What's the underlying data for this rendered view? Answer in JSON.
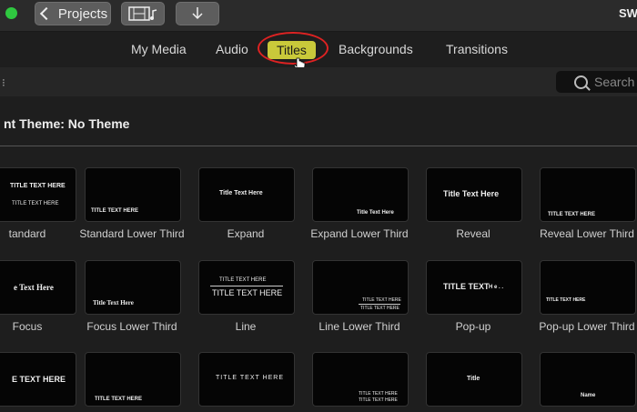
{
  "toolbar": {
    "projects_label": "Projects",
    "app_title": "SW"
  },
  "tabs": [
    {
      "label": "My Media"
    },
    {
      "label": "Audio"
    },
    {
      "label": "Titles"
    },
    {
      "label": "Backgrounds"
    },
    {
      "label": "Transitions"
    }
  ],
  "search": {
    "placeholder": "Search"
  },
  "heading": "nt Theme: No Theme",
  "tiles": [
    {
      "label": "tandard",
      "thumb_text": [
        "TITLE TEXT HERE",
        "TITLE TEXT HERE"
      ]
    },
    {
      "label": "Standard Lower Third",
      "thumb_text": [
        "TITLE TEXT HERE"
      ]
    },
    {
      "label": "Expand",
      "thumb_text": [
        "Title Text Here"
      ]
    },
    {
      "label": "Expand Lower Third",
      "thumb_text": [
        "Title Text Here"
      ]
    },
    {
      "label": "Reveal",
      "thumb_text": [
        "Title Text Here"
      ]
    },
    {
      "label": "Reveal Lower Third",
      "thumb_text": [
        "TITLE TEXT HERE"
      ]
    },
    {
      "label": "Focus",
      "thumb_text": [
        "e Text Here"
      ]
    },
    {
      "label": "Focus Lower Third",
      "thumb_text": [
        "Title Text Here"
      ]
    },
    {
      "label": "Line",
      "thumb_text": [
        "TITLE TEXT HERE",
        "TITLE TEXT HERE"
      ]
    },
    {
      "label": "Line Lower Third",
      "thumb_text": [
        "TITLE TEXT HERE",
        "TITLE TEXT HERE"
      ]
    },
    {
      "label": "Pop-up",
      "thumb_text": [
        "TITLE TEXT"
      ]
    },
    {
      "label": "Pop-up Lower Third",
      "thumb_text": [
        "TITLE TEXT HERE"
      ]
    },
    {
      "label": "",
      "thumb_text": [
        "E TEXT HERE"
      ]
    },
    {
      "label": "",
      "thumb_text": [
        "TITLE TEXT HERE"
      ]
    },
    {
      "label": "",
      "thumb_text": [
        "TITLE TEXT HERE"
      ]
    },
    {
      "label": "",
      "thumb_text": [
        "TITLE TEXT HERE",
        "TITLE TEXT HERE"
      ]
    },
    {
      "label": "",
      "thumb_text": [
        "Title"
      ]
    },
    {
      "label": "",
      "thumb_text": [
        "Name"
      ]
    }
  ]
}
